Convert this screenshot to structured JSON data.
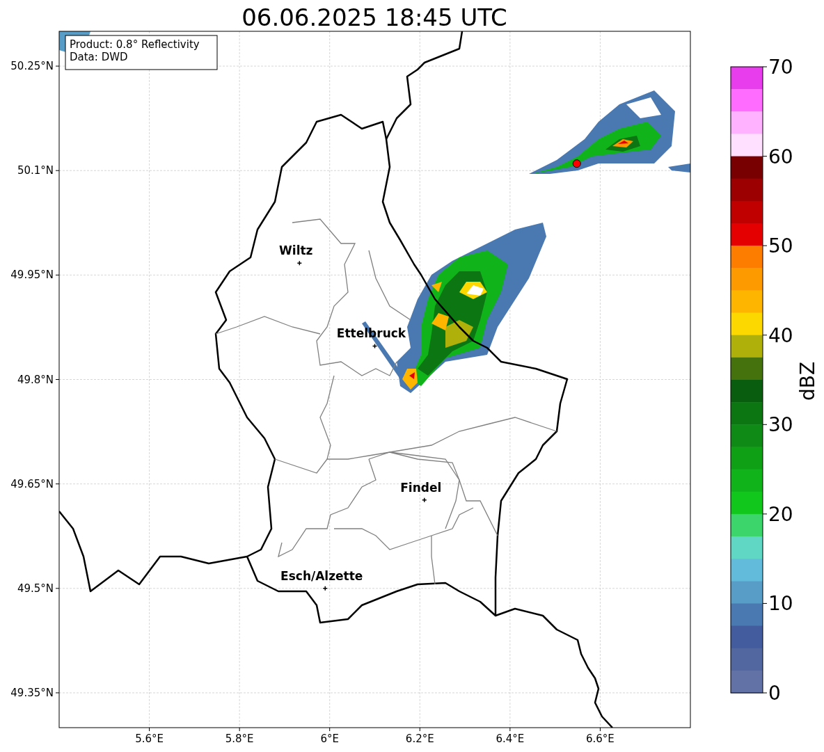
{
  "title": "06.06.2025 18:45 UTC",
  "info_box": [
    "Product: 0.8° Reflectivity",
    "Data: DWD"
  ],
  "map": {
    "xticks": [
      "5.6°E",
      "5.8°E",
      "6°E",
      "6.2°E",
      "6.4°E",
      "6.6°E"
    ],
    "yticks": [
      "50.25°N",
      "50.1°N",
      "49.95°N",
      "49.8°N",
      "49.65°N",
      "49.5°N",
      "49.35°N"
    ],
    "cities": [
      {
        "name": "Wiltz"
      },
      {
        "name": "Ettelbruck"
      },
      {
        "name": "Findel"
      },
      {
        "name": "Esch/Alzette"
      }
    ]
  },
  "colorbar": {
    "label": "dBZ",
    "ticks": [
      "70",
      "60",
      "50",
      "40",
      "30",
      "20",
      "10",
      "0"
    ],
    "bins": [
      {
        "color": "#e83ded"
      },
      {
        "color": "#ff6cff"
      },
      {
        "color": "#ffb2ff"
      },
      {
        "color": "#ffe0ff"
      },
      {
        "color": "#780000"
      },
      {
        "color": "#9d0000"
      },
      {
        "color": "#c00000"
      },
      {
        "color": "#e40000"
      },
      {
        "color": "#fd7d00"
      },
      {
        "color": "#fd9a00"
      },
      {
        "color": "#fdb500"
      },
      {
        "color": "#fdd700"
      },
      {
        "color": "#afb00a"
      },
      {
        "color": "#46720e"
      },
      {
        "color": "#085e0e"
      },
      {
        "color": "#0b7612"
      },
      {
        "color": "#0f8a16"
      },
      {
        "color": "#10a016"
      },
      {
        "color": "#10b41a"
      },
      {
        "color": "#11c71c"
      },
      {
        "color": "#3bd56c"
      },
      {
        "color": "#60d6c4"
      },
      {
        "color": "#62bbdb"
      },
      {
        "color": "#589cc8"
      },
      {
        "color": "#4a78b0"
      },
      {
        "color": "#435c9e"
      },
      {
        "color": "#52669f"
      },
      {
        "color": "#6271a6"
      }
    ]
  }
}
